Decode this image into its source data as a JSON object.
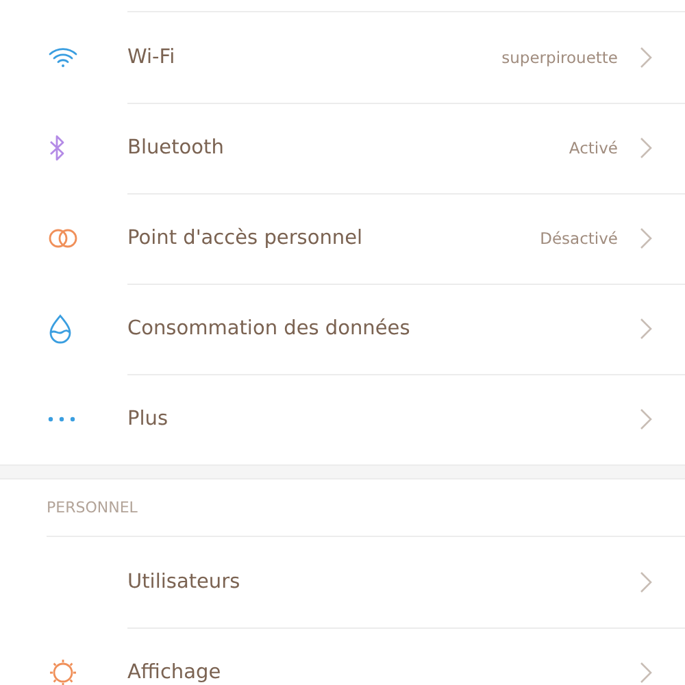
{
  "sections": [
    {
      "items": [
        {
          "label": "Wi-Fi",
          "value": "superpirouette"
        },
        {
          "label": "Bluetooth",
          "value": "Activé"
        },
        {
          "label": "Point d'accès personnel",
          "value": "Désactivé"
        },
        {
          "label": "Consommation des données"
        },
        {
          "label": "Plus"
        }
      ]
    },
    {
      "header": "PERSONNEL",
      "items": [
        {
          "label": "Utilisateurs"
        },
        {
          "label": "Affichage"
        }
      ]
    }
  ]
}
